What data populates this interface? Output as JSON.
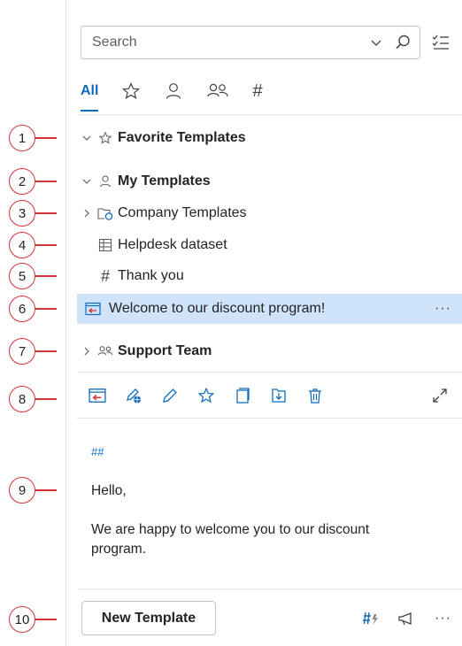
{
  "callouts": [
    "1",
    "2",
    "3",
    "4",
    "5",
    "6",
    "7",
    "8",
    "9",
    "10"
  ],
  "search": {
    "placeholder": "Search"
  },
  "tabs": [
    {
      "label": "All",
      "icon": null
    },
    {
      "label": "",
      "icon": "star-icon"
    },
    {
      "label": "",
      "icon": "person-icon"
    },
    {
      "label": "",
      "icon": "people-icon"
    },
    {
      "label": "#",
      "icon": "hashtag-icon"
    }
  ],
  "tree": {
    "favorite": "Favorite Templates",
    "my_templates": "My Templates",
    "company": "Company Templates",
    "helpdesk": "Helpdesk dataset",
    "thank_you": "Thank you",
    "welcome": "Welcome to our discount program!",
    "support_team": "Support Team",
    "more_label": "···"
  },
  "preview": {
    "tag": "##",
    "greeting": "Hello,",
    "body": "We are happy to welcome you to our discount program."
  },
  "footer": {
    "new_template": "New Template",
    "more_label": "···"
  },
  "colors": {
    "accent": "#0f6cbd",
    "callout": "#d13438",
    "selected": "#cfe4fa"
  }
}
